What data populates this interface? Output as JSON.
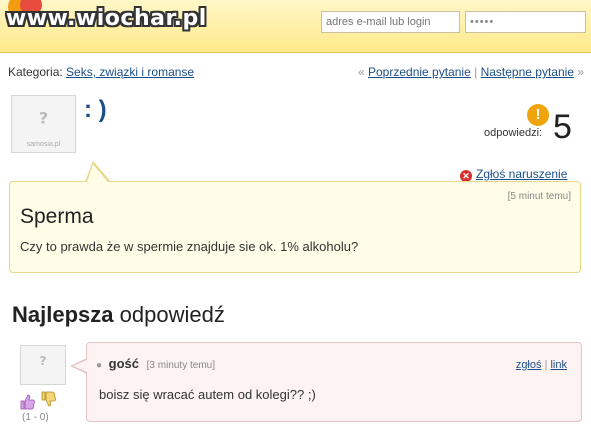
{
  "header": {
    "watermark": "www.wiochar.pl",
    "email_placeholder": "adres e-mail lub login",
    "password_value": "•••••"
  },
  "category": {
    "label": "Kategoria:",
    "value": "Seks, związki i romanse"
  },
  "nav": {
    "prev_prefix": "«",
    "prev": "Poprzednie pytanie",
    "sep": "|",
    "next": "Następne pytanie",
    "next_suffix": "»"
  },
  "question": {
    "username": ": )",
    "avatar_caption": "samosia.pl",
    "answers_label": "odpowiedzi:",
    "answers_count": "5",
    "report": "Zgłoś naruszenie",
    "time": "[5 minut temu]",
    "title": "Sperma",
    "text": "Czy to prawda że w spermie znajduje sie ok. 1% alkoholu?"
  },
  "best_answer": {
    "heading_bold": "Najlepsza",
    "heading_rest": "odpowiedź",
    "author": "gość",
    "time": "[3 minuty temu]",
    "report_link": "zgłoś",
    "link_link": "link",
    "link_sep": "|",
    "text": "boisz się wracać autem od kolegi?? ;)",
    "votes": "(1 - 0)"
  },
  "colors": {
    "link": "#1b4f8a",
    "question_bg": "#fffce8",
    "answer_bg": "#fdf3f3",
    "answers_icon": "#f0a30a",
    "report_icon": "#d9302c"
  },
  "icons": [
    "logo-icon",
    "answers-count-icon",
    "report-icon",
    "thumb-up-icon",
    "thumb-down-icon",
    "avatar-icon"
  ]
}
